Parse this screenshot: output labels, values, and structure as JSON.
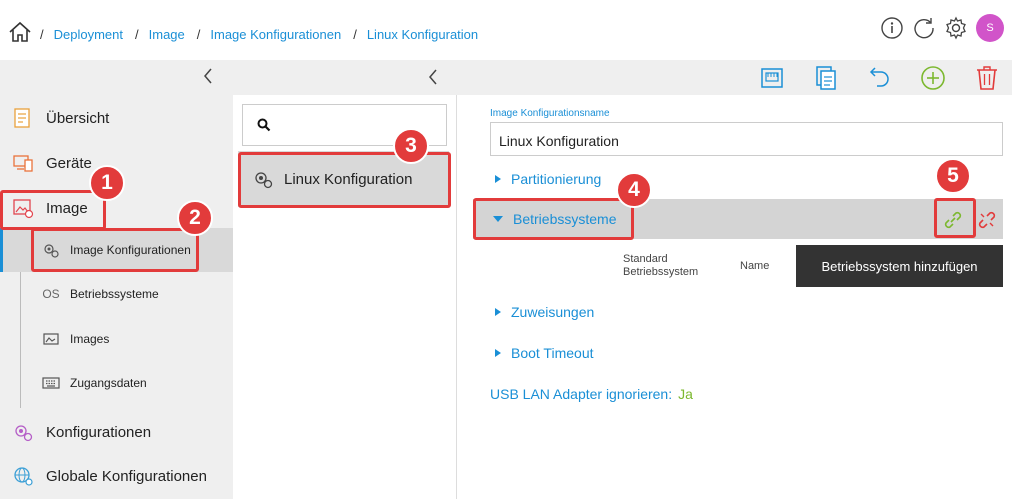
{
  "breadcrumb": {
    "separator": "/",
    "items": [
      "Deployment",
      "Image",
      "Image Konfigurationen",
      "Linux Konfiguration"
    ]
  },
  "header": {
    "avatar_initial": "S",
    "icons": [
      "info-icon",
      "refresh-icon",
      "gear-icon"
    ]
  },
  "sidebar": {
    "items": [
      {
        "label": "Übersicht",
        "icon": "overview-icon"
      },
      {
        "label": "Geräte",
        "icon": "devices-icon"
      },
      {
        "label": "Image",
        "icon": "image-icon"
      },
      {
        "label": "Konfigurationen",
        "icon": "configurations-icon"
      },
      {
        "label": "Globale Konfigurationen",
        "icon": "global-configurations-icon"
      }
    ],
    "sub_items": [
      {
        "label": "Image Konfigurationen",
        "icon": "gears-icon",
        "active": true
      },
      {
        "label": "Betriebssysteme",
        "icon_text": "OS"
      },
      {
        "label": "Images",
        "icon": "picture-icon"
      },
      {
        "label": "Zugangsdaten",
        "icon": "keyboard-icon"
      }
    ]
  },
  "list": {
    "search_placeholder": "",
    "items": [
      {
        "label": "Linux Konfiguration",
        "icon": "gears-icon"
      }
    ]
  },
  "toolbar": {
    "icons": [
      "network-icon",
      "copy-icon",
      "undo-icon",
      "add-icon",
      "delete-icon"
    ]
  },
  "form": {
    "name_label": "Image Konfigurationsname",
    "name_value": "Linux Konfiguration",
    "sections": {
      "partitioning": "Partitionierung",
      "operating_systems": "Betriebssysteme",
      "assignments": "Zuweisungen",
      "boot_timeout": "Boot Timeout"
    },
    "columns": {
      "standard_os_line1": "Standard",
      "standard_os_line2": "Betriebssystem",
      "name": "Name"
    },
    "tooltip": "Betriebssystem hinzufügen",
    "usb_label": "USB LAN Adapter ignorieren:",
    "usb_value": "Ja"
  },
  "annotations": [
    "1",
    "2",
    "3",
    "4",
    "5"
  ],
  "colors": {
    "accent": "#1a8fd6",
    "highlight": "#e23b3b",
    "success": "#7cb82f",
    "avatar": "#d154c9"
  }
}
